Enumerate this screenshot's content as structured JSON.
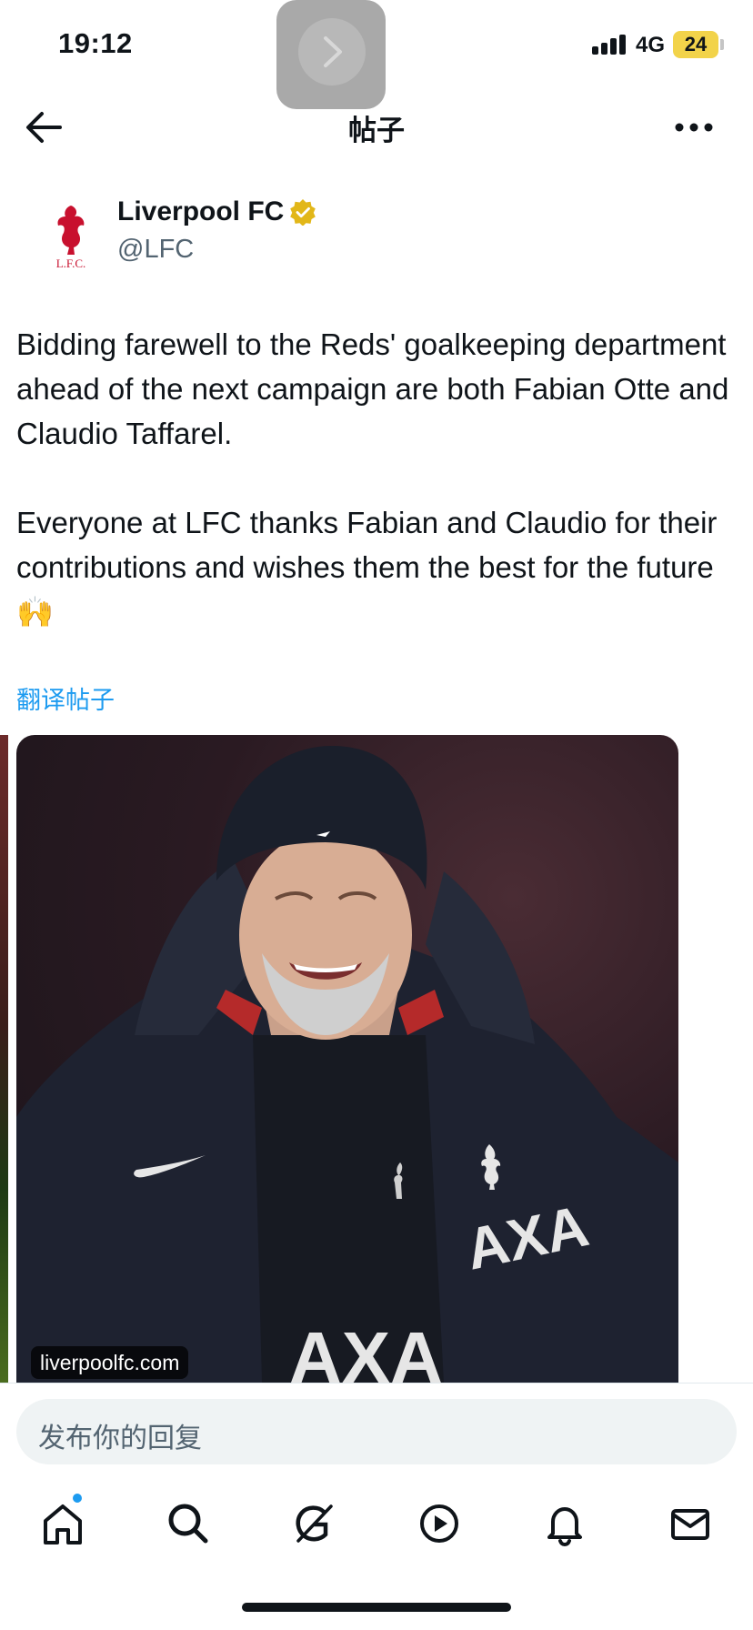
{
  "status_bar": {
    "time": "19:12",
    "network": "4G",
    "battery": "24",
    "battery_color": "#f2d34a"
  },
  "nav": {
    "title": "帖子",
    "back_icon": "arrow-left-icon",
    "more_icon": "more-horizontal-icon"
  },
  "author": {
    "name": "Liverpool FC",
    "handle": "@LFC",
    "verified_color": "#e2b719",
    "avatar_label": "L.F.C."
  },
  "post": {
    "paragraphs": [
      "Bidding farewell to the Reds' goalkeeping department ahead of the next campaign are both Fabian Otte and Claudio Taffarel.",
      "Everyone at LFC thanks Fabian and Claudio for their contributions and wishes them the best for the future 🙌"
    ],
    "translate_label": "翻译帖子",
    "link_color": "#1d9bf0"
  },
  "media": {
    "source_badge": "liverpoolfc.com"
  },
  "reply": {
    "placeholder": "发布你的回复"
  },
  "tabbar": {
    "items": [
      {
        "name": "home",
        "icon": "home-icon",
        "badge": true
      },
      {
        "name": "search",
        "icon": "search-icon"
      },
      {
        "name": "grok",
        "icon": "grok-icon"
      },
      {
        "name": "video",
        "icon": "play-icon"
      },
      {
        "name": "notifications",
        "icon": "bell-icon"
      },
      {
        "name": "messages",
        "icon": "mail-icon"
      }
    ]
  }
}
